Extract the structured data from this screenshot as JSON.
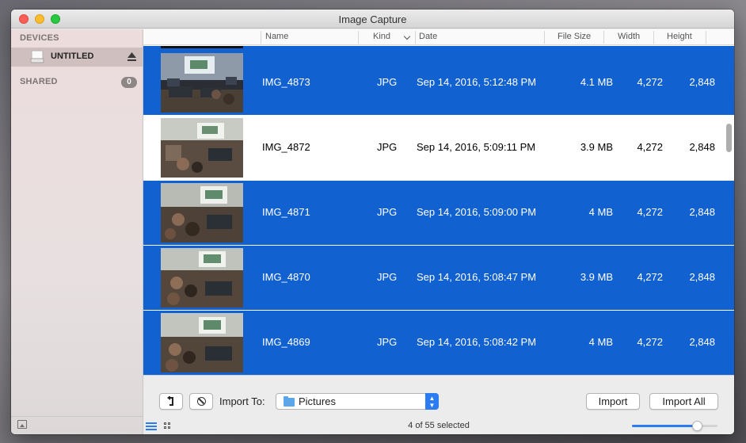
{
  "window": {
    "title": "Image Capture"
  },
  "sidebar": {
    "devices_heading": "DEVICES",
    "device": {
      "label": "UNTITLED",
      "icon": "drive-icon",
      "selected": true
    },
    "shared_heading": "SHARED",
    "shared_count": "0"
  },
  "table": {
    "columns": [
      "Name",
      "Kind",
      "Date",
      "File Size",
      "Width",
      "Height"
    ],
    "sort_column": "Kind",
    "rows": [
      {
        "name": "IMG_4873",
        "kind": "JPG",
        "date": "Sep 14, 2016, 5:12:48 PM",
        "size": "4.1 MB",
        "width": "4,272",
        "height": "2,848",
        "selected": true
      },
      {
        "name": "IMG_4872",
        "kind": "JPG",
        "date": "Sep 14, 2016, 5:09:11 PM",
        "size": "3.9 MB",
        "width": "4,272",
        "height": "2,848",
        "selected": false
      },
      {
        "name": "IMG_4871",
        "kind": "JPG",
        "date": "Sep 14, 2016, 5:09:00 PM",
        "size": "4 MB",
        "width": "4,272",
        "height": "2,848",
        "selected": true
      },
      {
        "name": "IMG_4870",
        "kind": "JPG",
        "date": "Sep 14, 2016, 5:08:47 PM",
        "size": "3.9 MB",
        "width": "4,272",
        "height": "2,848",
        "selected": true
      },
      {
        "name": "IMG_4869",
        "kind": "JPG",
        "date": "Sep 14, 2016, 5:08:42 PM",
        "size": "4 MB",
        "width": "4,272",
        "height": "2,848",
        "selected": true
      }
    ]
  },
  "toolbar": {
    "rotate_icon": "rotate-left-icon",
    "delete_icon": "delete-icon",
    "import_to_label": "Import To:",
    "import_destination": "Pictures",
    "import_label": "Import",
    "import_all_label": "Import All"
  },
  "status": {
    "selection_text": "4 of 55 selected",
    "thumbnail_size": 0.76
  },
  "colors": {
    "selection": "#1261d1",
    "accent": "#2b7cf3"
  }
}
